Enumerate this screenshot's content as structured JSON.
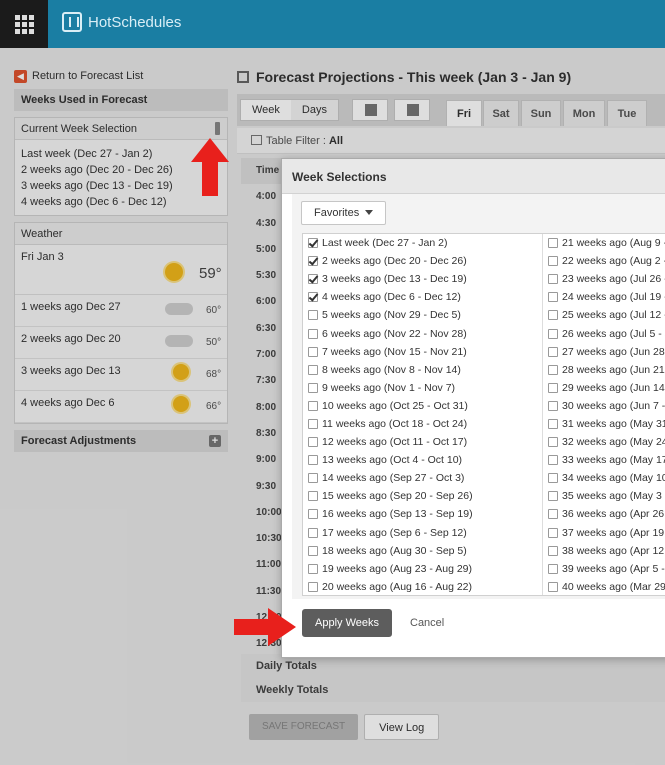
{
  "app": {
    "logo": "HotSchedules"
  },
  "colors": {
    "topbar": "#1a7ea3",
    "accent_red": "#e8201c"
  },
  "left": {
    "return_link": "Return to Forecast List",
    "weeks_header": "Weeks Used in Forecast",
    "current_selection_title": "Current Week Selection",
    "weeks": [
      "Last week (Dec 27 - Jan 2)",
      "2 weeks ago (Dec 20 - Dec 26)",
      "3 weeks ago (Dec 13 - Dec 19)",
      "4 weeks ago (Dec 6 - Dec 12)"
    ],
    "weather_title": "Weather",
    "weather_today": {
      "label": "Fri Jan 3",
      "temp": "59°",
      "icon": "sun-icon"
    },
    "weather_rows": [
      {
        "label": "1 weeks ago Dec 27",
        "temp": "60°",
        "icon": "cloudy-icon"
      },
      {
        "label": "2 weeks ago Dec 20",
        "temp": "50°",
        "icon": "rain-cloud-icon"
      },
      {
        "label": "3 weeks ago Dec 13",
        "temp": "68°",
        "icon": "sun-icon"
      },
      {
        "label": "4 weeks ago Dec 6",
        "temp": "66°",
        "icon": "sun-icon"
      }
    ],
    "adjustments": "Forecast Adjustments"
  },
  "main": {
    "title": "Forecast Projections - This week (Jan 3 - Jan 9)",
    "view_toggle": [
      "Week",
      "Days"
    ],
    "days": [
      "Fri",
      "Sat",
      "Sun",
      "Mon",
      "Tue"
    ],
    "filter_label": "Table Filter :",
    "filter_value": "All",
    "time_header": "Time",
    "times": [
      "4:00",
      "4:30",
      "5:00",
      "5:30",
      "6:00",
      "6:30",
      "7:00",
      "7:30",
      "8:00",
      "8:30",
      "9:00",
      "9:30",
      "10:00",
      "10:30",
      "11:00",
      "11:30",
      "12:00",
      "12:30"
    ],
    "daily_totals": "Daily Totals",
    "weekly_totals": "Weekly Totals",
    "save_button": "SAVE FORECAST",
    "view_log_button": "View Log"
  },
  "modal": {
    "title": "Week Selections",
    "favorites": "Favorites",
    "left_column": [
      {
        "label": "Last week (Dec 27 - Jan 2)",
        "checked": true
      },
      {
        "label": "2 weeks ago (Dec 20 - Dec 26)",
        "checked": true
      },
      {
        "label": "3 weeks ago (Dec 13 - Dec 19)",
        "checked": true
      },
      {
        "label": "4 weeks ago (Dec 6 - Dec 12)",
        "checked": true
      },
      {
        "label": "5 weeks ago (Nov 29 - Dec 5)",
        "checked": false
      },
      {
        "label": "6 weeks ago (Nov 22 - Nov 28)",
        "checked": false
      },
      {
        "label": "7 weeks ago (Nov 15 - Nov 21)",
        "checked": false
      },
      {
        "label": "8 weeks ago (Nov 8 - Nov 14)",
        "checked": false
      },
      {
        "label": "9 weeks ago (Nov 1 - Nov 7)",
        "checked": false
      },
      {
        "label": "10 weeks ago (Oct 25 - Oct 31)",
        "checked": false
      },
      {
        "label": "11 weeks ago (Oct 18 - Oct 24)",
        "checked": false
      },
      {
        "label": "12 weeks ago (Oct 11 - Oct 17)",
        "checked": false
      },
      {
        "label": "13 weeks ago (Oct 4 - Oct 10)",
        "checked": false
      },
      {
        "label": "14 weeks ago (Sep 27 - Oct 3)",
        "checked": false
      },
      {
        "label": "15 weeks ago (Sep 20 - Sep 26)",
        "checked": false
      },
      {
        "label": "16 weeks ago (Sep 13 - Sep 19)",
        "checked": false
      },
      {
        "label": "17 weeks ago (Sep 6 - Sep 12)",
        "checked": false
      },
      {
        "label": "18 weeks ago (Aug 30 - Sep 5)",
        "checked": false
      },
      {
        "label": "19 weeks ago (Aug 23 - Aug 29)",
        "checked": false
      },
      {
        "label": "20 weeks ago (Aug 16 - Aug 22)",
        "checked": false
      }
    ],
    "right_column": [
      {
        "label": "21 weeks ago (Aug 9 - A",
        "checked": false
      },
      {
        "label": "22 weeks ago (Aug 2 - A",
        "checked": false
      },
      {
        "label": "23 weeks ago (Jul 26 - A",
        "checked": false
      },
      {
        "label": "24 weeks ago (Jul 19 - Ju",
        "checked": false
      },
      {
        "label": "25 weeks ago (Jul 12 - Ju",
        "checked": false
      },
      {
        "label": "26 weeks ago (Jul 5 - Jul",
        "checked": false
      },
      {
        "label": "27 weeks ago (Jun 28 - J",
        "checked": false
      },
      {
        "label": "28 weeks ago (Jun 21 - J",
        "checked": false
      },
      {
        "label": "29 weeks ago (Jun 14 - J",
        "checked": false
      },
      {
        "label": "30 weeks ago (Jun 7 - Ju",
        "checked": false
      },
      {
        "label": "31 weeks ago (May 31 -",
        "checked": false
      },
      {
        "label": "32 weeks ago (May 24 -",
        "checked": false
      },
      {
        "label": "33 weeks ago (May 17 -",
        "checked": false
      },
      {
        "label": "34 weeks ago (May 10 -",
        "checked": false
      },
      {
        "label": "35 weeks ago (May 3 - M",
        "checked": false
      },
      {
        "label": "36 weeks ago (Apr 26 - .",
        "checked": false
      },
      {
        "label": "37 weeks ago (Apr 19 - .",
        "checked": false
      },
      {
        "label": "38 weeks ago (Apr 12 - .",
        "checked": false
      },
      {
        "label": "39 weeks ago (Apr 5 - A",
        "checked": false
      },
      {
        "label": "40 weeks ago (Mar 29 -",
        "checked": false
      }
    ],
    "apply_button": "Apply Weeks",
    "cancel_button": "Cancel"
  }
}
